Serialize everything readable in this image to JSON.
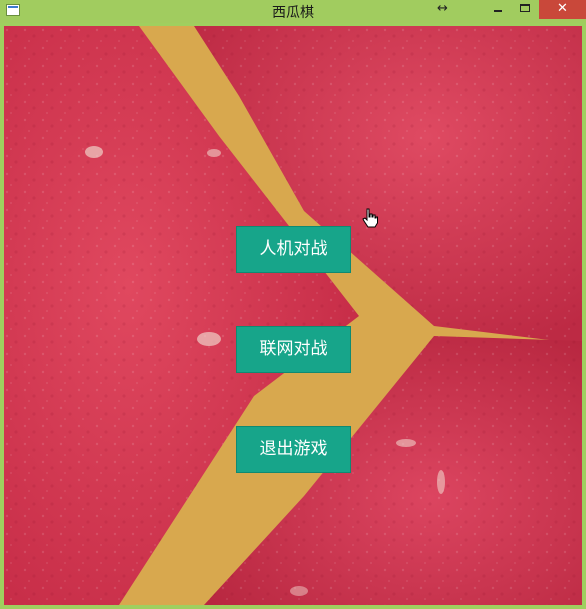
{
  "window": {
    "title": "西瓜棋",
    "close_glyph": "✕",
    "resize_glyph": "↔"
  },
  "menu": {
    "pve_label": "人机对战",
    "online_label": "联网对战",
    "exit_label": "退出游戏"
  },
  "icons": [
    "app-icon",
    "resize-icon",
    "minimize-icon",
    "maximize-icon",
    "close-icon",
    "hand-cursor-icon"
  ],
  "colors": {
    "titlebar": "#a1cc5f",
    "close": "#c9483a",
    "button": "#17a58a",
    "melon_flesh": "#d83a54",
    "melon_dark": "#c02842",
    "rind_gap": "#d8a84e"
  }
}
